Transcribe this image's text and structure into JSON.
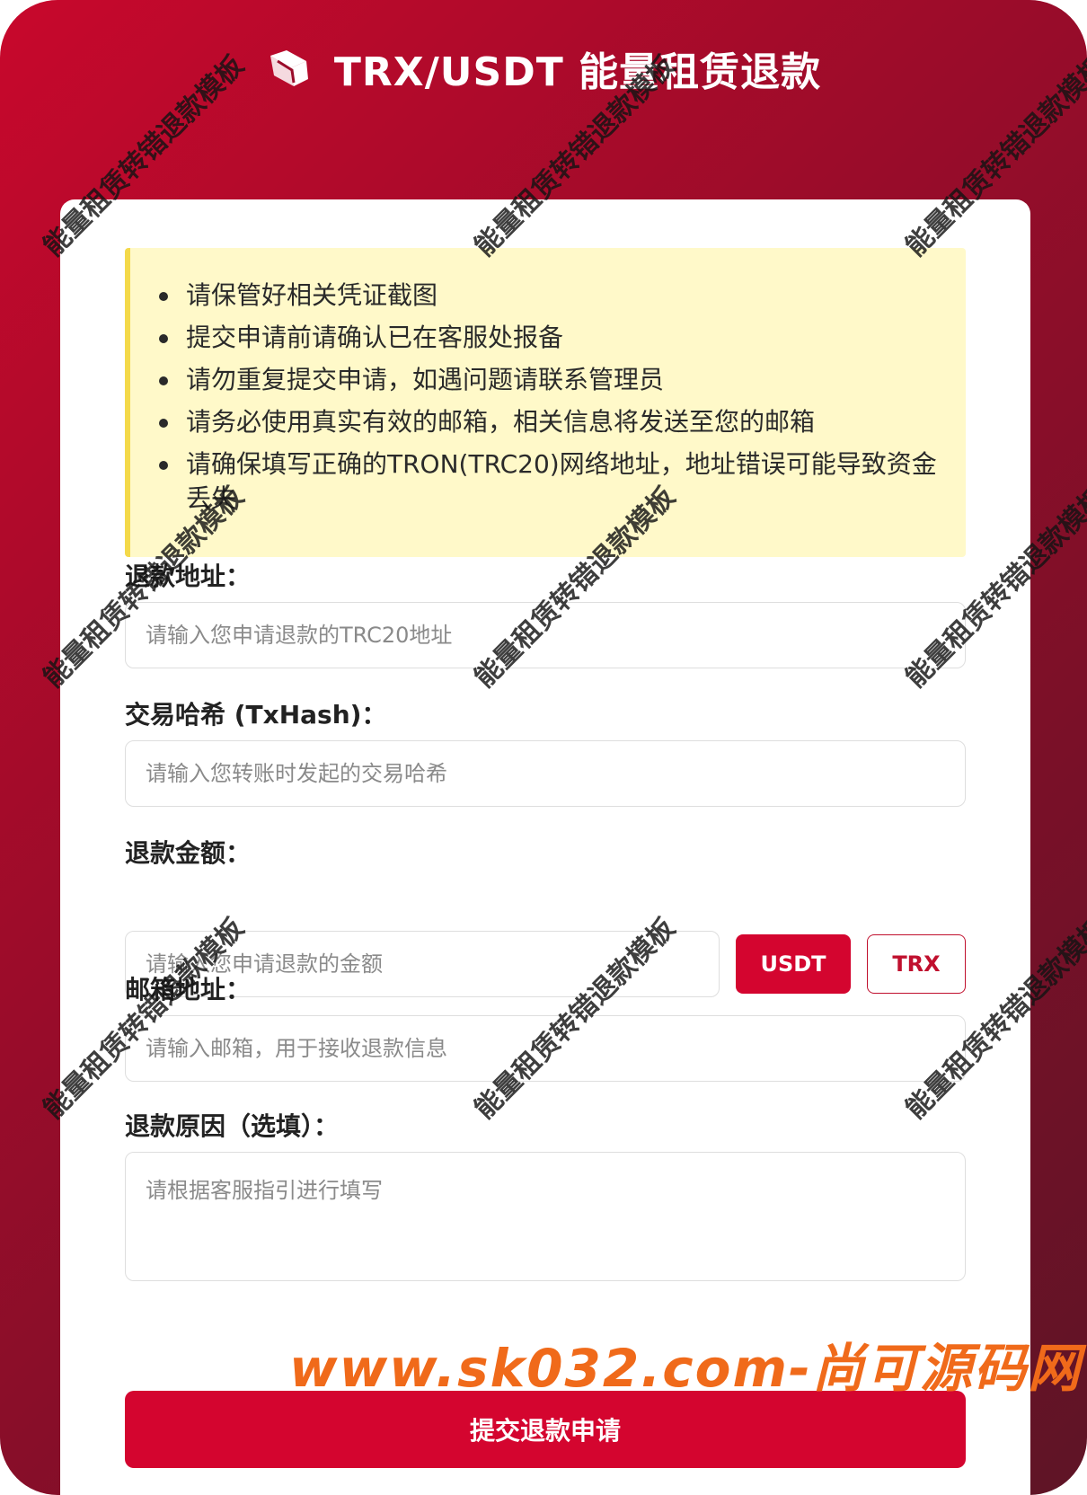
{
  "colors": {
    "accent": "#d4052f",
    "notice_bg": "#fff9c9",
    "notice_border": "#f4d94a",
    "site_mark": "#f06a1a"
  },
  "header": {
    "title": "TRX/USDT 能量租赁退款",
    "logo_icon": "cube-logo-icon"
  },
  "notice": {
    "items": [
      "请保管好相关凭证截图",
      "提交申请前请确认已在客服处报备",
      "请勿重复提交申请，如遇问题请联系管理员",
      "请务必使用真实有效的邮箱，相关信息将发送至您的邮箱",
      "请确保填写正确的TRON(TRC20)网络地址，地址错误可能导致资金丢失"
    ]
  },
  "form": {
    "address": {
      "label": "退款地址：",
      "placeholder": "请输入您申请退款的TRC20地址"
    },
    "txhash": {
      "label": "交易哈希 (TxHash)：",
      "placeholder": "请输入您转账时发起的交易哈希"
    },
    "amount": {
      "label": "退款金额：",
      "placeholder": "请输入您申请退款的金额",
      "currency_usdt": "USDT",
      "currency_trx": "TRX",
      "selected": "USDT"
    },
    "email": {
      "label": "邮箱地址：",
      "placeholder": "请输入邮箱，用于接收退款信息"
    },
    "reason": {
      "label": "退款原因（选填）：",
      "placeholder": "请根据客服指引进行填写"
    },
    "submit_label": "提交退款申请"
  },
  "watermark": {
    "text": "能量租赁转错退款模板"
  },
  "site_mark": "www.sk032.com-尚可源码网"
}
